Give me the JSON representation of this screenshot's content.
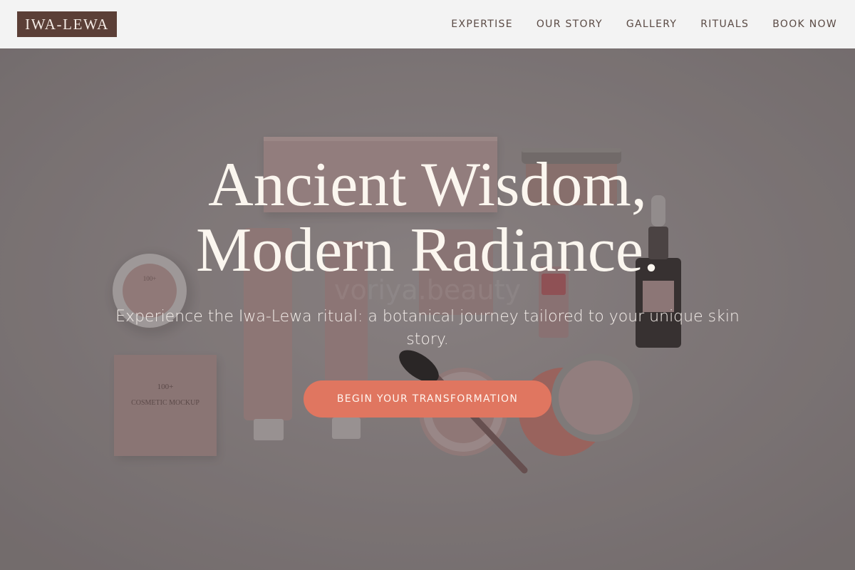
{
  "brand": {
    "logo_text": "IWA-LEWA"
  },
  "nav": {
    "items": [
      {
        "label": "EXPERTISE"
      },
      {
        "label": "OUR STORY"
      },
      {
        "label": "GALLERY"
      },
      {
        "label": "RITUALS"
      },
      {
        "label": "BOOK NOW"
      }
    ]
  },
  "hero": {
    "headline_line1": "Ancient Wisdom,",
    "headline_line2": "Modern Radiance.",
    "subtitle": "Experience the Iwa-Lewa ritual: a botanical journey tailored to your unique skin story.",
    "cta_label": "BEGIN YOUR TRANSFORMATION",
    "image_watermark": "voriya.beauty",
    "product_label_text": [
      "100+",
      "COSMETIC MOCKUP"
    ]
  },
  "colors": {
    "header_bg": "#f3f3f3",
    "logo_bg": "#5b3f37",
    "nav_text": "#5a4a44",
    "hero_bg": "#8b8485",
    "cta_bg": "#e07660",
    "headline_text": "#fbf6ef"
  }
}
